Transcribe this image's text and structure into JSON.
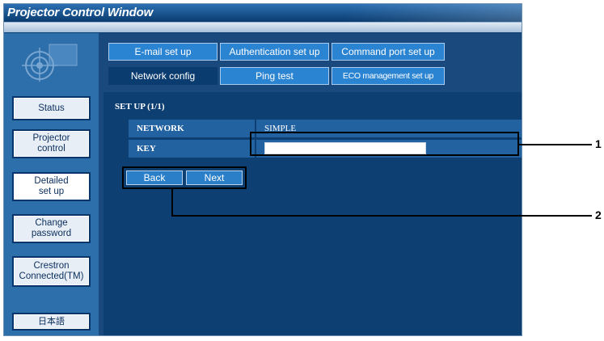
{
  "window": {
    "title": "Projector Control Window"
  },
  "sidebar": {
    "items": [
      {
        "label": "Status"
      },
      {
        "label": "Projector\ncontrol"
      },
      {
        "label": "Detailed\nset up"
      },
      {
        "label": "Change\npassword"
      },
      {
        "label": "Crestron\nConnected(TM)"
      },
      {
        "label": "日本語"
      }
    ]
  },
  "tabs": {
    "row1": [
      "E-mail set up",
      "Authentication set up",
      "Command port set up"
    ],
    "row2": [
      "Network config",
      "Ping test",
      "ECO management set up"
    ]
  },
  "setup": {
    "label": "SET UP (1/1)",
    "rows": [
      {
        "name": "NETWORK",
        "value": "SIMPLE"
      },
      {
        "name": "KEY",
        "value": ""
      }
    ]
  },
  "buttons": {
    "back": "Back",
    "next": "Next"
  },
  "callouts": [
    "1",
    "2"
  ]
}
